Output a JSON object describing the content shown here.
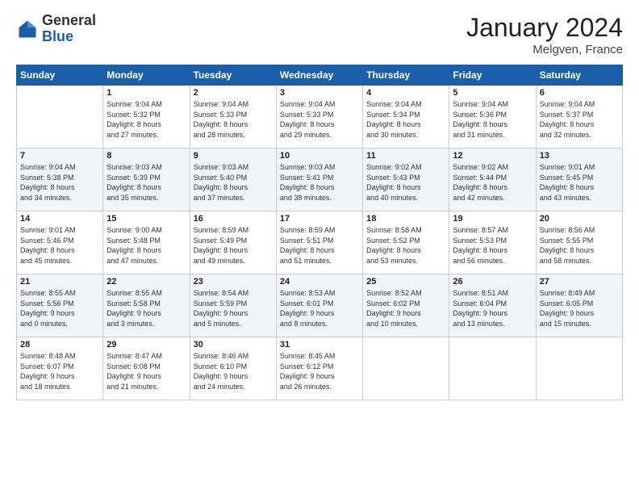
{
  "header": {
    "logo_general": "General",
    "logo_blue": "Blue",
    "month_title": "January 2024",
    "location": "Melgven, France"
  },
  "weekdays": [
    "Sunday",
    "Monday",
    "Tuesday",
    "Wednesday",
    "Thursday",
    "Friday",
    "Saturday"
  ],
  "weeks": [
    [
      {
        "day": "",
        "info": ""
      },
      {
        "day": "1",
        "info": "Sunrise: 9:04 AM\nSunset: 5:32 PM\nDaylight: 8 hours\nand 27 minutes."
      },
      {
        "day": "2",
        "info": "Sunrise: 9:04 AM\nSunset: 5:33 PM\nDaylight: 8 hours\nand 28 minutes."
      },
      {
        "day": "3",
        "info": "Sunrise: 9:04 AM\nSunset: 5:33 PM\nDaylight: 8 hours\nand 29 minutes."
      },
      {
        "day": "4",
        "info": "Sunrise: 9:04 AM\nSunset: 5:34 PM\nDaylight: 8 hours\nand 30 minutes."
      },
      {
        "day": "5",
        "info": "Sunrise: 9:04 AM\nSunset: 5:36 PM\nDaylight: 8 hours\nand 31 minutes."
      },
      {
        "day": "6",
        "info": "Sunrise: 9:04 AM\nSunset: 5:37 PM\nDaylight: 8 hours\nand 32 minutes."
      }
    ],
    [
      {
        "day": "7",
        "info": "Sunrise: 9:04 AM\nSunset: 5:38 PM\nDaylight: 8 hours\nand 34 minutes."
      },
      {
        "day": "8",
        "info": "Sunrise: 9:03 AM\nSunset: 5:39 PM\nDaylight: 8 hours\nand 35 minutes."
      },
      {
        "day": "9",
        "info": "Sunrise: 9:03 AM\nSunset: 5:40 PM\nDaylight: 8 hours\nand 37 minutes."
      },
      {
        "day": "10",
        "info": "Sunrise: 9:03 AM\nSunset: 5:41 PM\nDaylight: 8 hours\nand 38 minutes."
      },
      {
        "day": "11",
        "info": "Sunrise: 9:02 AM\nSunset: 5:43 PM\nDaylight: 8 hours\nand 40 minutes."
      },
      {
        "day": "12",
        "info": "Sunrise: 9:02 AM\nSunset: 5:44 PM\nDaylight: 8 hours\nand 42 minutes."
      },
      {
        "day": "13",
        "info": "Sunrise: 9:01 AM\nSunset: 5:45 PM\nDaylight: 8 hours\nand 43 minutes."
      }
    ],
    [
      {
        "day": "14",
        "info": "Sunrise: 9:01 AM\nSunset: 5:46 PM\nDaylight: 8 hours\nand 45 minutes."
      },
      {
        "day": "15",
        "info": "Sunrise: 9:00 AM\nSunset: 5:48 PM\nDaylight: 8 hours\nand 47 minutes."
      },
      {
        "day": "16",
        "info": "Sunrise: 8:59 AM\nSunset: 5:49 PM\nDaylight: 8 hours\nand 49 minutes."
      },
      {
        "day": "17",
        "info": "Sunrise: 8:59 AM\nSunset: 5:51 PM\nDaylight: 8 hours\nand 51 minutes."
      },
      {
        "day": "18",
        "info": "Sunrise: 8:58 AM\nSunset: 5:52 PM\nDaylight: 8 hours\nand 53 minutes."
      },
      {
        "day": "19",
        "info": "Sunrise: 8:57 AM\nSunset: 5:53 PM\nDaylight: 8 hours\nand 56 minutes."
      },
      {
        "day": "20",
        "info": "Sunrise: 8:56 AM\nSunset: 5:55 PM\nDaylight: 8 hours\nand 58 minutes."
      }
    ],
    [
      {
        "day": "21",
        "info": "Sunrise: 8:55 AM\nSunset: 5:56 PM\nDaylight: 9 hours\nand 0 minutes."
      },
      {
        "day": "22",
        "info": "Sunrise: 8:55 AM\nSunset: 5:58 PM\nDaylight: 9 hours\nand 3 minutes."
      },
      {
        "day": "23",
        "info": "Sunrise: 8:54 AM\nSunset: 5:59 PM\nDaylight: 9 hours\nand 5 minutes."
      },
      {
        "day": "24",
        "info": "Sunrise: 8:53 AM\nSunset: 6:01 PM\nDaylight: 9 hours\nand 8 minutes."
      },
      {
        "day": "25",
        "info": "Sunrise: 8:52 AM\nSunset: 6:02 PM\nDaylight: 9 hours\nand 10 minutes."
      },
      {
        "day": "26",
        "info": "Sunrise: 8:51 AM\nSunset: 6:04 PM\nDaylight: 9 hours\nand 13 minutes."
      },
      {
        "day": "27",
        "info": "Sunrise: 8:49 AM\nSunset: 6:05 PM\nDaylight: 9 hours\nand 15 minutes."
      }
    ],
    [
      {
        "day": "28",
        "info": "Sunrise: 8:48 AM\nSunset: 6:07 PM\nDaylight: 9 hours\nand 18 minutes."
      },
      {
        "day": "29",
        "info": "Sunrise: 8:47 AM\nSunset: 6:08 PM\nDaylight: 9 hours\nand 21 minutes."
      },
      {
        "day": "30",
        "info": "Sunrise: 8:46 AM\nSunset: 6:10 PM\nDaylight: 9 hours\nand 24 minutes."
      },
      {
        "day": "31",
        "info": "Sunrise: 8:45 AM\nSunset: 6:12 PM\nDaylight: 9 hours\nand 26 minutes."
      },
      {
        "day": "",
        "info": ""
      },
      {
        "day": "",
        "info": ""
      },
      {
        "day": "",
        "info": ""
      }
    ]
  ]
}
